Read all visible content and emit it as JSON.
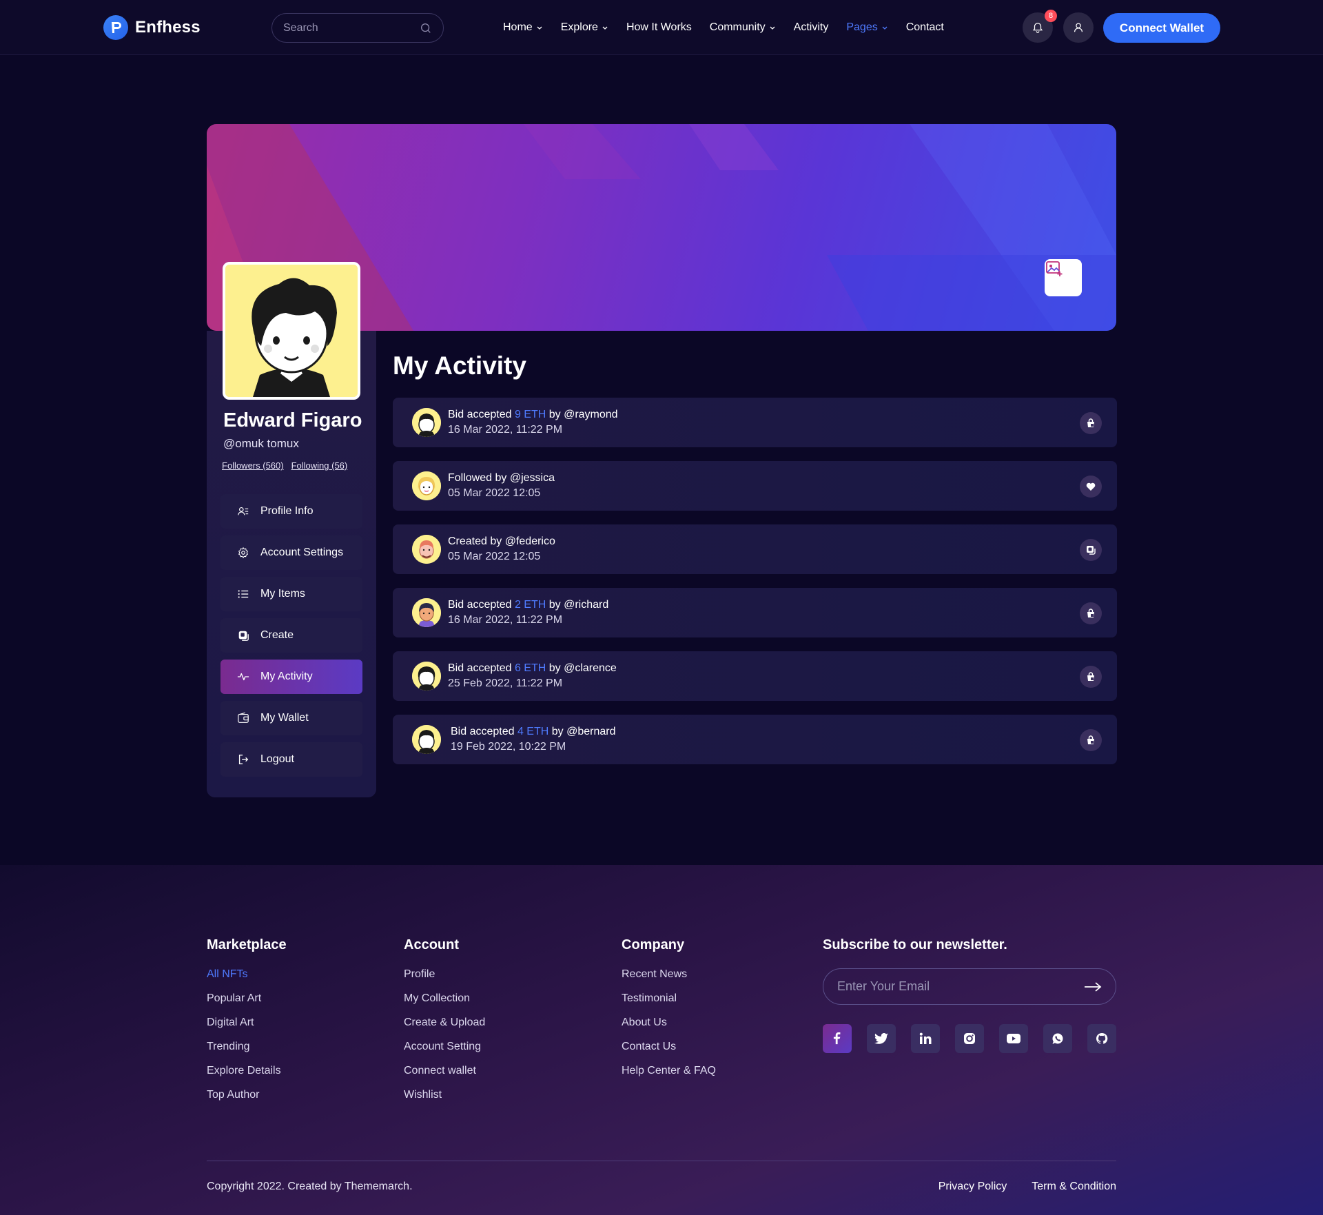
{
  "header": {
    "brand": "Enfhess",
    "search_placeholder": "Search",
    "nav": [
      {
        "label": "Home"
      },
      {
        "label": "Explore"
      },
      {
        "label": "How It Works"
      },
      {
        "label": "Community"
      },
      {
        "label": "Activity"
      },
      {
        "label": "Pages"
      },
      {
        "label": "Contact"
      }
    ],
    "notification_count": "8",
    "connect_label": "Connect Wallet",
    "accent_color": "#2f6bf6"
  },
  "profile": {
    "name": "Edward Figaro",
    "handle": "@omuk tomux",
    "followers": "Followers (560)",
    "following": "Following (56)"
  },
  "menu": [
    {
      "label": "Profile Info",
      "icon": "profile-info-icon"
    },
    {
      "label": "Account Settings",
      "icon": "settings-icon"
    },
    {
      "label": "My Items",
      "icon": "list-icon"
    },
    {
      "label": "Create",
      "icon": "create-icon"
    },
    {
      "label": "My Activity",
      "icon": "activity-icon"
    },
    {
      "label": "My Wallet",
      "icon": "wallet-icon"
    },
    {
      "label": "Logout",
      "icon": "logout-icon"
    }
  ],
  "activity": {
    "title": "My Activity",
    "items": [
      {
        "pre": "Bid accepted ",
        "eth": "9 ETH",
        "post": " by @raymond",
        "time": "16 Mar 2022, 11:22 PM",
        "icon": "shopping-bag-icon"
      },
      {
        "pre": "Followed by @jessica",
        "eth": "",
        "post": "",
        "time": "05 Mar 2022 12:05",
        "icon": "heart-icon"
      },
      {
        "pre": "Created by @federico",
        "eth": "",
        "post": "",
        "time": "05 Mar 2022 12:05",
        "icon": "create-icon"
      },
      {
        "pre": "Bid accepted ",
        "eth": "2 ETH",
        "post": " by @richard",
        "time": "16 Mar 2022, 11:22 PM",
        "icon": "shopping-bag-icon"
      },
      {
        "pre": "Bid accepted ",
        "eth": "6 ETH",
        "post": " by @clarence",
        "time": "25 Feb 2022, 11:22 PM",
        "icon": "shopping-bag-icon"
      },
      {
        "pre": "Bid accepted ",
        "eth": "4 ETH",
        "post": " by @bernard",
        "time": "19 Feb 2022, 10:22 PM",
        "icon": "shopping-bag-icon"
      }
    ]
  },
  "footer": {
    "marketplace": {
      "title": "Marketplace",
      "links": [
        "All NFTs",
        "Popular Art",
        "Digital Art",
        "Trending",
        "Explore Details",
        "Top Author"
      ]
    },
    "account": {
      "title": "Account",
      "links": [
        "Profile",
        "My Collection",
        "Create & Upload",
        "Account Setting",
        "Connect wallet",
        "Wishlist"
      ]
    },
    "company": {
      "title": "Company",
      "links": [
        "Recent News",
        "Testimonial",
        "About Us",
        "Contact Us",
        "Help Center & FAQ"
      ]
    },
    "newsletter": {
      "title": "Subscribe to our newsletter.",
      "placeholder": "Enter Your Email"
    },
    "socials": [
      "facebook-icon",
      "twitter-icon",
      "linkedin-icon",
      "instagram-icon",
      "youtube-icon",
      "whatsapp-icon",
      "github-icon"
    ],
    "copyright": "Copyright 2022. Created by Thememarch.",
    "privacy": "Privacy Policy",
    "terms": "Term & Condition"
  }
}
